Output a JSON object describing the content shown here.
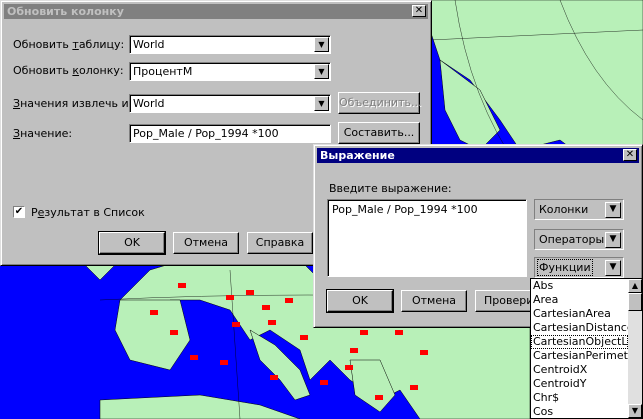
{
  "update_dialog": {
    "title": "Обновить колонку",
    "close_glyph": "✕",
    "table_label_pre": "Обновить ",
    "table_label_u": "т",
    "table_label_post": "аблицу:",
    "table_value": "World",
    "column_label_pre": "Обновить ",
    "column_label_u": "к",
    "column_label_post": "олонку:",
    "column_value": "ПроцентМ",
    "source_label_pre": "",
    "source_label_u": "З",
    "source_label_post": "начения извлечь из:",
    "source_value": "World",
    "join_button": "Объединить...",
    "value_label_pre": "",
    "value_label_u": "З",
    "value_label_post": "начение:",
    "value_text": "Pop_Male / Pop_1994 *100",
    "compose_button": "Составить...",
    "result_checkbox_checked": true,
    "result_label_pre": "Р",
    "result_label_u": "е",
    "result_label_post": "зультат в Список",
    "ok_button": "OK",
    "cancel_button": "Отмена",
    "help_button": "Справка"
  },
  "expr_dialog": {
    "title": "Выражение",
    "close_glyph": "✕",
    "prompt": "Введите выражение:",
    "expression": "Pop_Male / Pop_1994 *100",
    "columns_label": "Колонки",
    "operators_label": "Операторы",
    "functions_label": "Функции",
    "ok_button": "OK",
    "cancel_button": "Отмена",
    "check_button": "Проверить"
  },
  "functions_list": {
    "items": [
      "Abs",
      "Area",
      "CartesianArea",
      "CartesianDistance",
      "CartesianObjectLen",
      "CartesianPerimeter",
      "CentroidX",
      "CentroidY",
      "Chr$",
      "Cos"
    ],
    "selected": "CartesianObjectLen"
  },
  "colors": {
    "sea": "#0000ff",
    "land": "#b8f0b8",
    "flag": "#ff0000",
    "dialog_face": "#c0c0c0",
    "active_title": "#000080",
    "inactive_title": "#808080"
  }
}
